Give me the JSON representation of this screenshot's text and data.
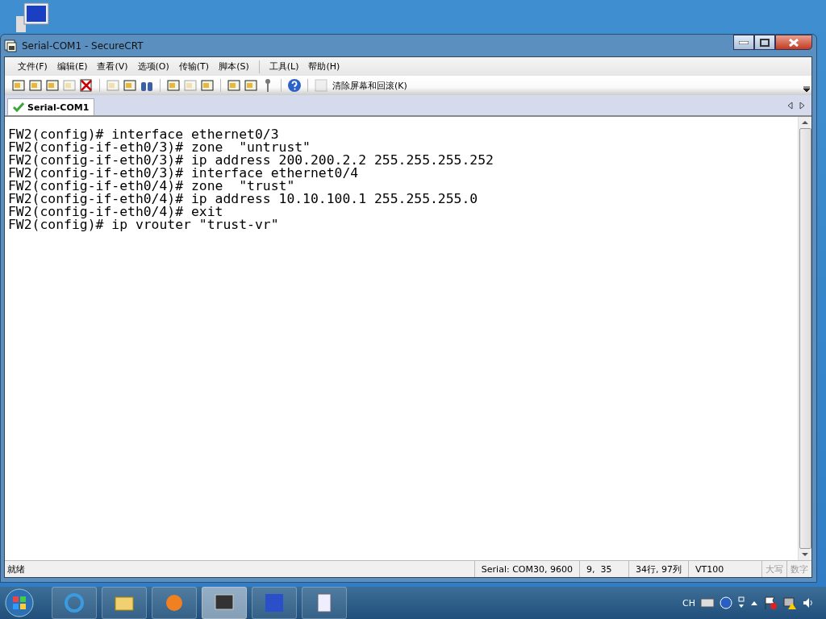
{
  "window": {
    "title": "Serial-COM1 - SecureCRT"
  },
  "menu": [
    "文件(F)",
    "编辑(E)",
    "查看(V)",
    "选项(O)",
    "传输(T)",
    "脚本(S)",
    "工具(L)",
    "帮助(H)"
  ],
  "toolbar": {
    "clear_button": "清除屏幕和回滚(K)"
  },
  "tabs": [
    {
      "label": "Serial-COM1",
      "selected": true
    }
  ],
  "terminal": {
    "lines": [
      "FW2(config)# interface ethernet0/3",
      "FW2(config-if-eth0/3)# zone  \"untrust\"",
      "FW2(config-if-eth0/3)# ip address 200.200.2.2 255.255.255.252",
      "FW2(config-if-eth0/3)# interface ethernet0/4",
      "FW2(config-if-eth0/4)# zone  \"trust\"",
      "FW2(config-if-eth0/4)# ip address 10.10.100.1 255.255.255.0",
      "FW2(config-if-eth0/4)# exit",
      "FW2(config)# ip vrouter \"trust-vr\""
    ]
  },
  "status_bar": {
    "message": "就绪",
    "connection": "Serial: COM30, 9600",
    "cursor": "9,  35",
    "size": "34行, 97列",
    "emulation": "VT100",
    "caps": "大写",
    "num": "数字"
  },
  "taskbar": {
    "apps": [
      {
        "selected": false
      },
      {
        "selected": false
      },
      {
        "selected": false
      },
      {
        "selected": true
      },
      {
        "selected": false
      },
      {
        "selected": false
      }
    ],
    "language": "CH"
  }
}
